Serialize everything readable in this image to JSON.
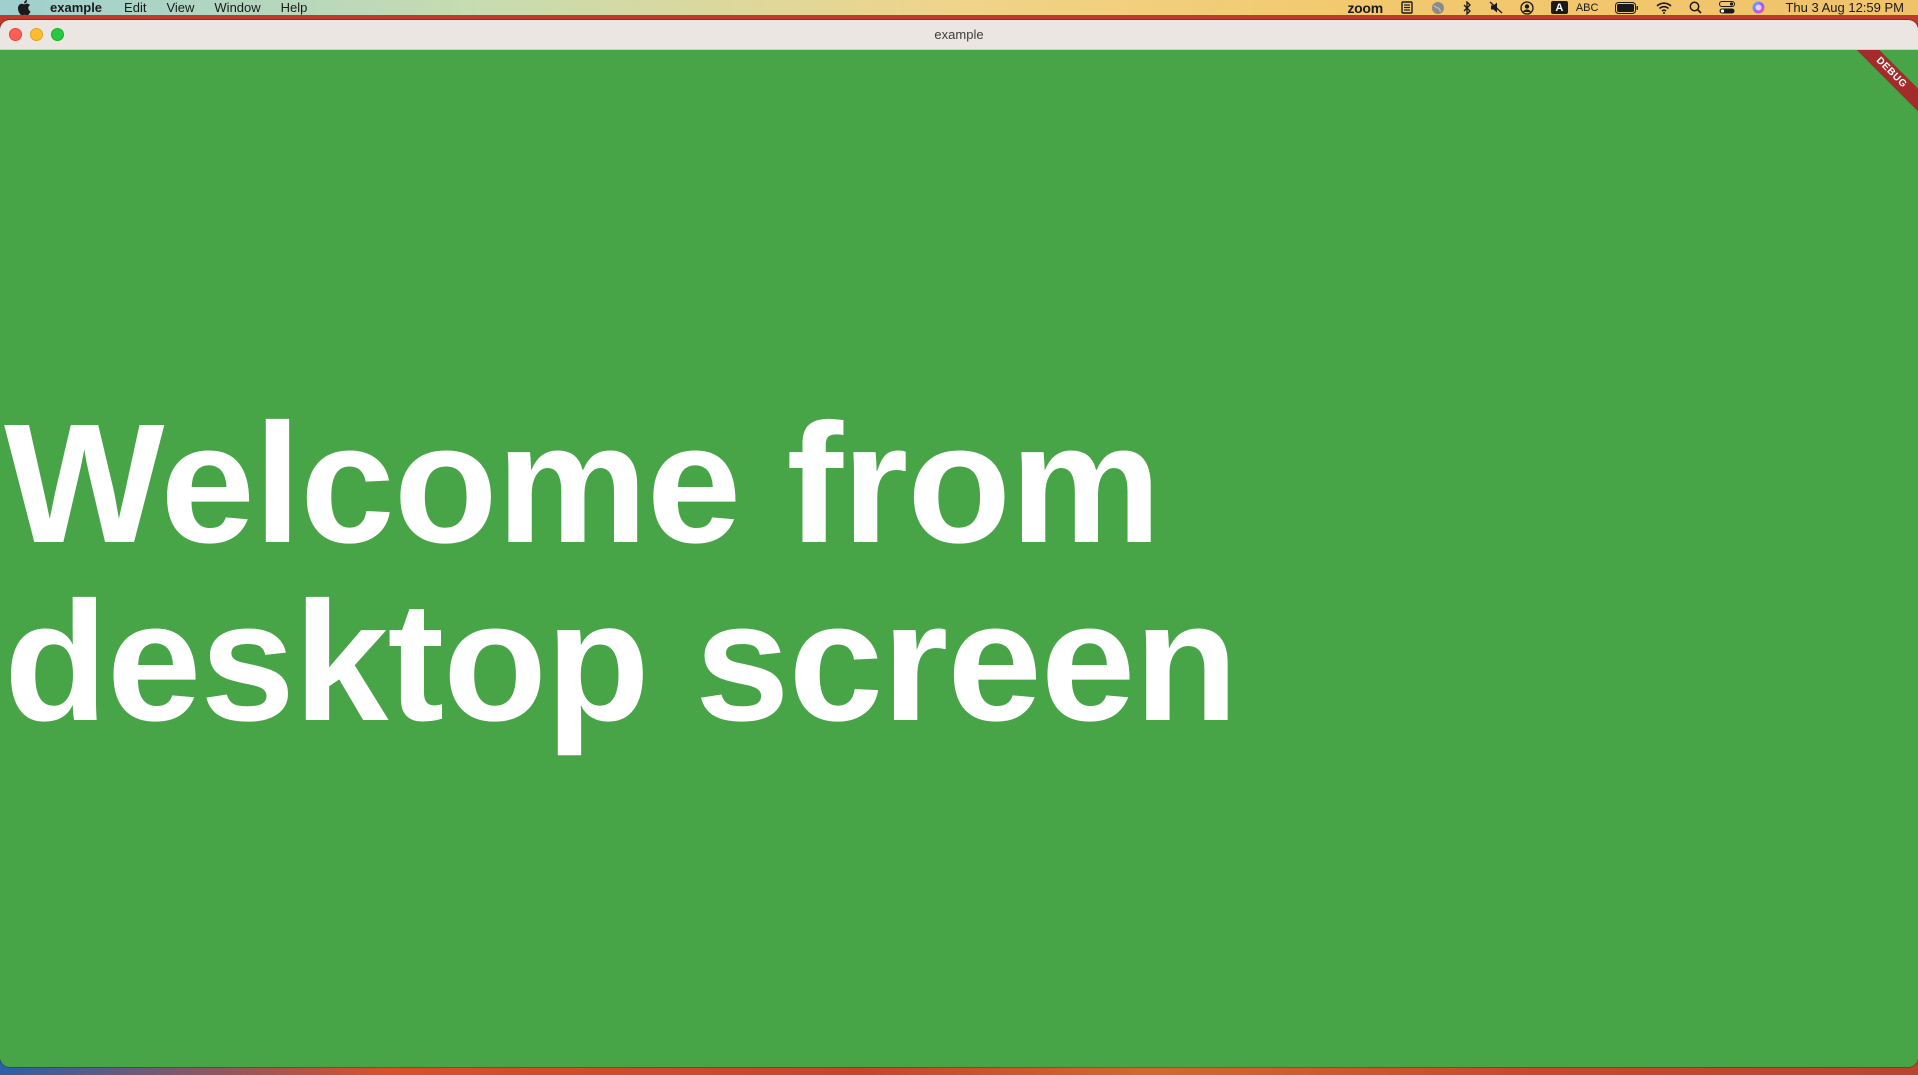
{
  "menubar": {
    "app_name": "example",
    "items": [
      {
        "label": "Edit"
      },
      {
        "label": "View"
      },
      {
        "label": "Window"
      },
      {
        "label": "Help"
      }
    ],
    "status": {
      "zoom": "zoom",
      "input_letter": "A",
      "input_source": "ABC",
      "clock": "Thu 3 Aug  12:59 PM"
    }
  },
  "window": {
    "title": "example",
    "background_color": "#47a548"
  },
  "content": {
    "heading": "Welcome from desktop screen"
  },
  "debug_banner": {
    "label": "DEBUG",
    "color": "#a52a2a"
  }
}
